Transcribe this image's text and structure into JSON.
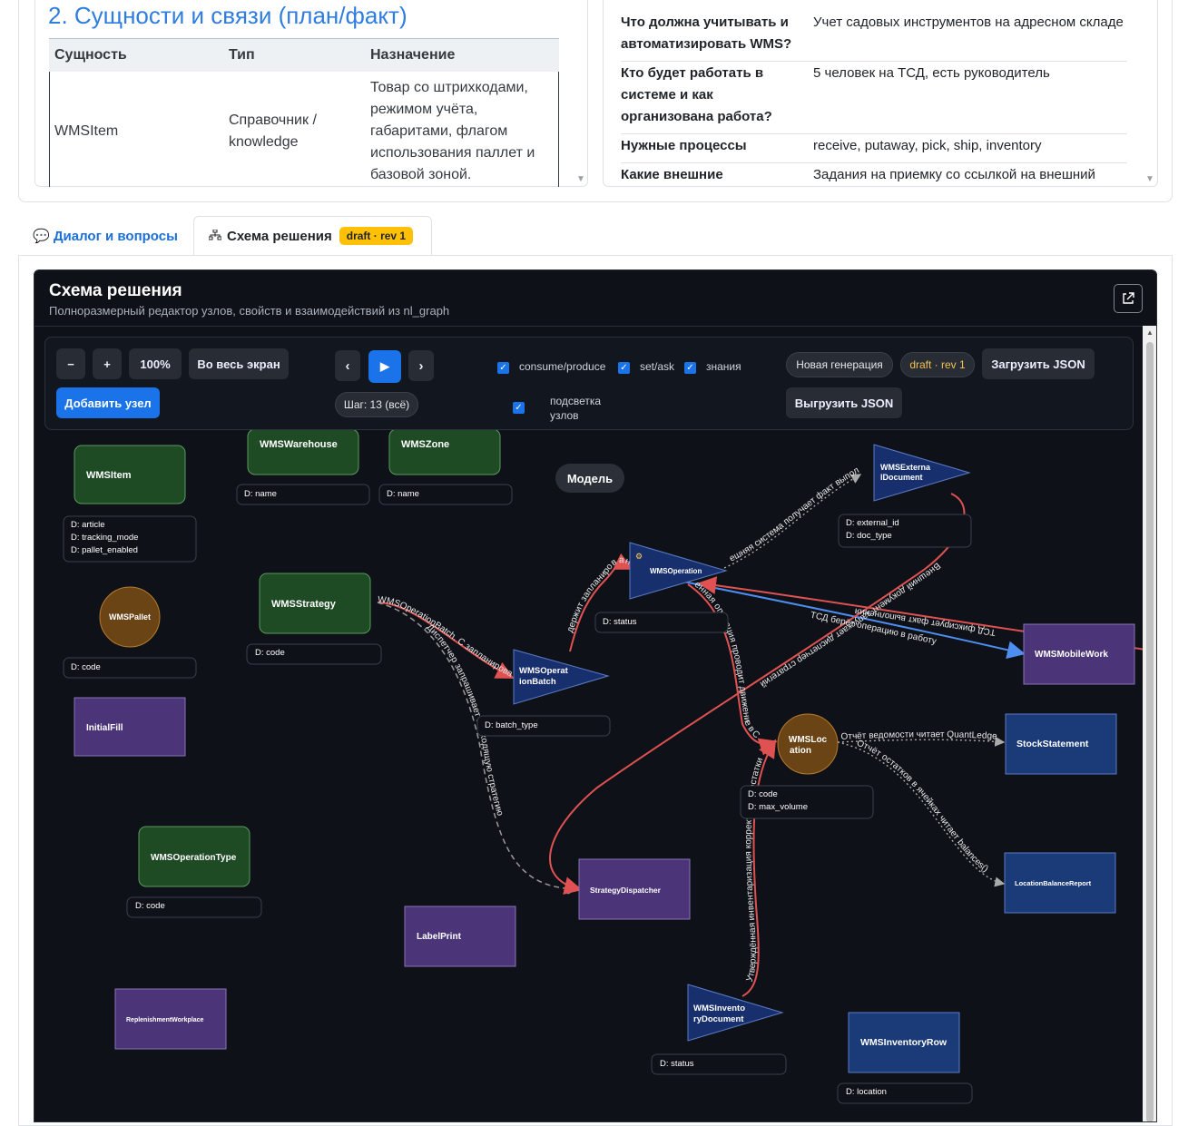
{
  "entities_section": {
    "title": "2. Сущности и связи (план/факт)",
    "columns": [
      "Сущность",
      "Тип",
      "Назначение"
    ],
    "rows": [
      {
        "entity": "WMSItem",
        "type": "Справочник / knowledge",
        "purpose": "Товар со штрихкодами, режимом учёта, габаритами, флагом использования паллет и базовой зоной."
      }
    ]
  },
  "questions": [
    {
      "q": "Что должна учитывать и автоматизировать WMS?",
      "a": "Учет садовых инструментов на адресном складе"
    },
    {
      "q": "Кто будет работать в системе и как организована работа?",
      "a": "5 человек на ТСД, есть руководитель"
    },
    {
      "q": "Нужные процессы",
      "a": "receive, putaway, pick, ship, inventory"
    },
    {
      "q": "Какие внешние",
      "a": "Задания на приемку со ссылкой на внешний"
    }
  ],
  "tabs": {
    "dialog": "💬 Диалог и вопросы",
    "schema": "Схема решения",
    "schema_badge": "draft · rev 1"
  },
  "schema": {
    "title": "Схема решения",
    "subtitle": "Полноразмерный редактор узлов, свойств и взаимодействий из nl_graph"
  },
  "toolbar": {
    "zoom_out": "−",
    "zoom_in": "+",
    "zoom_level": "100%",
    "fullscreen": "Во весь экран",
    "add_node": "Добавить узел",
    "prev": "‹",
    "play": "▶",
    "next": "›",
    "step": "Шаг: 13 (всё)",
    "chk_consume": "consume/produce",
    "chk_setask": "set/ask",
    "chk_knowledge": "знания",
    "chk_highlight": "подсветка узлов",
    "new_generation": "Новая генерация",
    "draft_badge": "draft · rev 1",
    "load_json": "Загрузить JSON",
    "export_json": "Выгрузить JSON"
  },
  "colors": {
    "knowledge": "#1e4a24",
    "entity": "#6a4414",
    "process": "#182f6e",
    "report": "#1a3a78",
    "ui": "#4b3578",
    "edge_red": "#e05252",
    "edge_blue": "#4d8ef0",
    "edge_gray": "#aaaaaa"
  },
  "graph": {
    "model_label": "Модель",
    "nodes": [
      {
        "id": "WMSItem",
        "label": "WMSItem",
        "props": [
          "D: article",
          "D: tracking_mode",
          "D: pallet_enabled"
        ]
      },
      {
        "id": "WMSWarehouse",
        "label": "WMSWarehouse",
        "props": [
          "D: name"
        ]
      },
      {
        "id": "WMSZone",
        "label": "WMSZone",
        "props": [
          "D: name"
        ]
      },
      {
        "id": "WMSPallet",
        "label": "WMSPallet",
        "props": [
          "D: code"
        ]
      },
      {
        "id": "WMSStrategy",
        "label": "WMSStrategy",
        "props": [
          "D: code"
        ]
      },
      {
        "id": "InitialFill",
        "label": "InitialFill",
        "props": []
      },
      {
        "id": "WMSOperationType",
        "label": "WMSOperationType",
        "props": [
          "D: code"
        ]
      },
      {
        "id": "LabelPrint",
        "label": "LabelPrint",
        "props": []
      },
      {
        "id": "ReplenishmentWorkplace",
        "label": "ReplenishmentWorkplace",
        "props": []
      },
      {
        "id": "WMSOperationBatch",
        "label": "WMSOperat\nionBatch",
        "props": [
          "D: batch_type"
        ]
      },
      {
        "id": "WMSOperation",
        "label": "WMSOperation",
        "props": [
          "D: status"
        ]
      },
      {
        "id": "WMSExternalDocument",
        "label": "WMSExterna\nlDocument",
        "props": [
          "D: external_id",
          "D: doc_type"
        ]
      },
      {
        "id": "WMSMobileWork",
        "label": "WMSMobileWork",
        "props": []
      },
      {
        "id": "WMSLocation",
        "label": "WMSLoc\nation",
        "props": [
          "D: code",
          "D: max_volume"
        ]
      },
      {
        "id": "StockStatement",
        "label": "StockStatement",
        "props": []
      },
      {
        "id": "LocationBalanceReport",
        "label": "LocationBalanceReport",
        "props": []
      },
      {
        "id": "StrategyDispatcher",
        "label": "StrategyDispatcher",
        "props": []
      },
      {
        "id": "WMSInventoryDocument",
        "label": "WMSInvento\nryDocument",
        "props": [
          "D: status"
        ]
      },
      {
        "id": "WMSInventoryRow",
        "label": "WMSInventoryRow",
        "props": [
          "D: location"
        ]
      }
    ],
    "edges": [
      {
        "from": "WMSStrategy",
        "to": "WMSOperationBatch",
        "label": "WMSOperationBatch. С запланирова"
      },
      {
        "from": "WMSStrategy",
        "to": "StrategyDispatcher",
        "label": "Диспетчер запрашивает подходящую стратегию"
      },
      {
        "from": "WMSOperationBatch",
        "to": "WMSOperation",
        "label": "держит запланированные"
      },
      {
        "from": "WMSOperation",
        "to": "WMSExternalDocument",
        "label": "ешняя система получает факт выполне"
      },
      {
        "from": "WMSOperation",
        "to": "WMSMobileWork",
        "label": "ТСД берёт операцию в работу"
      },
      {
        "from": "WMSMobileWork",
        "to": "WMSOperation",
        "label": "ТСД фиксирует факт выполнения"
      },
      {
        "from": "WMSOperation",
        "to": "WMSLocation",
        "label": "енная операция проводит движение в С"
      },
      {
        "from": "WMSExternalDocument",
        "to": "StrategyDispatcher",
        "label": "Внешний документ запускает диспетчер стратегий"
      },
      {
        "from": "WMSLocation",
        "to": "StockStatement",
        "label": "Отчёт ведомости читает QuantLedge"
      },
      {
        "from": "WMSLocation",
        "to": "LocationBalanceReport",
        "label": "Отчёт остатков в ячейках читает balances()"
      },
      {
        "from": "WMSInventoryDocument",
        "to": "WMSLocation",
        "label": "Утверждённая инвентаризация корректирует остатки"
      }
    ]
  }
}
